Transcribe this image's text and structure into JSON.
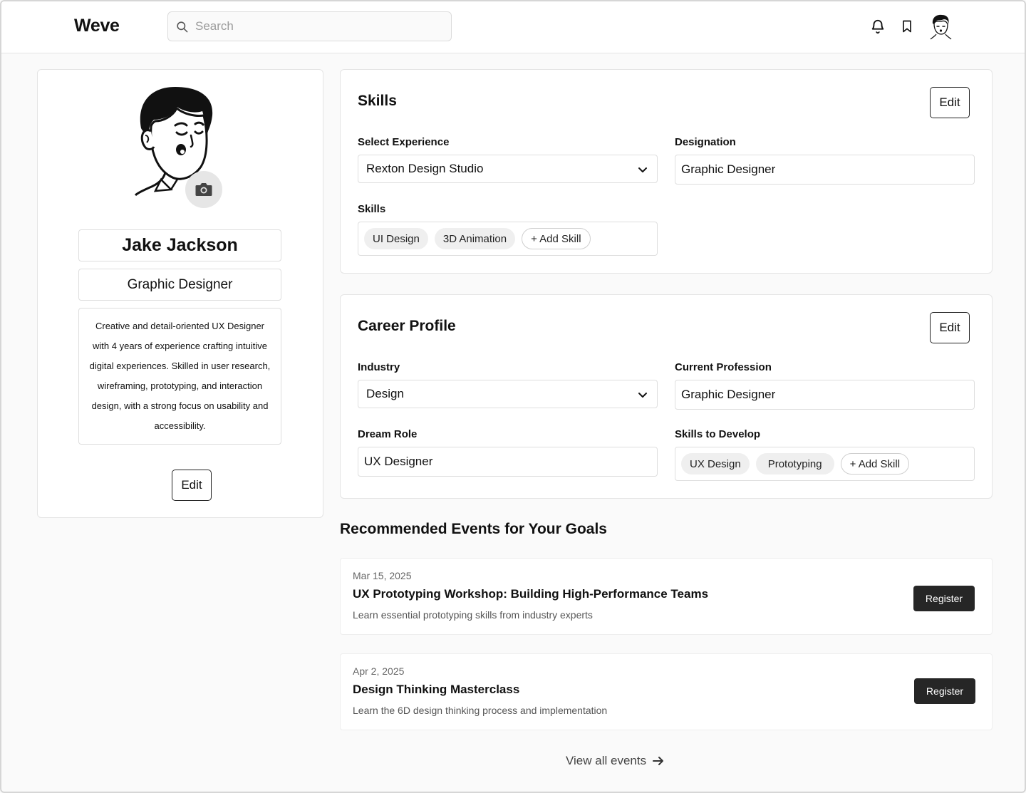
{
  "header": {
    "brand": "Weve",
    "search_placeholder": "Search",
    "icons": [
      "bell-icon",
      "bookmark-icon",
      "user-avatar"
    ]
  },
  "profile": {
    "name": "Jake Jackson",
    "role": "Graphic Designer",
    "bio": "Creative and detail-oriented UX Designer with 4 years of experience crafting intuitive digital experiences. Skilled in user research, wireframing, prototyping, and interaction design, with a strong focus on usability and accessibility.",
    "edit_label": "Edit"
  },
  "skills": {
    "title": "Skills",
    "edit_label": "Edit",
    "experience_label": "Select Experience",
    "experience_value": "Rexton Design Studio",
    "designation_label": "Designation",
    "designation_value": "Graphic Designer",
    "skills_label": "Skills",
    "chips": [
      "UI Design",
      "3D Animation"
    ],
    "add_label": "+ Add Skill"
  },
  "career": {
    "title": "Career Profile",
    "edit_label": "Edit",
    "industry_label": "Industry",
    "industry_value": "Design",
    "profession_label": "Current Profession",
    "profession_value": "Graphic Designer",
    "dream_label": "Dream Role",
    "dream_value": "UX Designer",
    "develop_label": "Skills to Develop",
    "chips": [
      "UX Design",
      "Prototyping"
    ],
    "add_label": "+ Add Skill"
  },
  "events": {
    "title": "Recommended Events for Your Goals",
    "items": [
      {
        "date": "Mar 15, 2025",
        "title": "UX Prototyping Workshop: Building High-Performance Teams",
        "description": "Learn essential prototyping skills from industry experts",
        "button": "Register"
      },
      {
        "date": "Apr 2, 2025",
        "title": "Design Thinking Masterclass",
        "description": "Learn the 6D design thinking process and implementation",
        "button": "Register"
      }
    ],
    "view_all": "View all events"
  }
}
